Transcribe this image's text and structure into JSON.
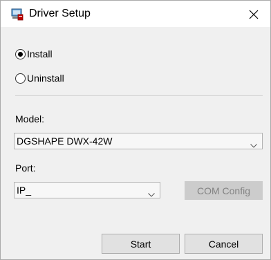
{
  "window": {
    "title": "Driver Setup",
    "app_icon": "printer-setup-icon",
    "close_icon": "close-icon"
  },
  "mode": {
    "selected": "install",
    "options": [
      {
        "id": "install",
        "label": "Install"
      },
      {
        "id": "uninstall",
        "label": "Uninstall"
      }
    ]
  },
  "model": {
    "label": "Model:",
    "value": "DGSHAPE DWX-42W"
  },
  "port": {
    "label": "Port:",
    "value": "IP_",
    "com_config_label": "COM Config",
    "com_config_enabled": false
  },
  "actions": {
    "start_label": "Start",
    "cancel_label": "Cancel"
  },
  "colors": {
    "window_bg": "#f0f0f0",
    "titlebar_bg": "#ffffff",
    "button_bg": "#e1e1e1",
    "disabled_text": "#838383"
  }
}
